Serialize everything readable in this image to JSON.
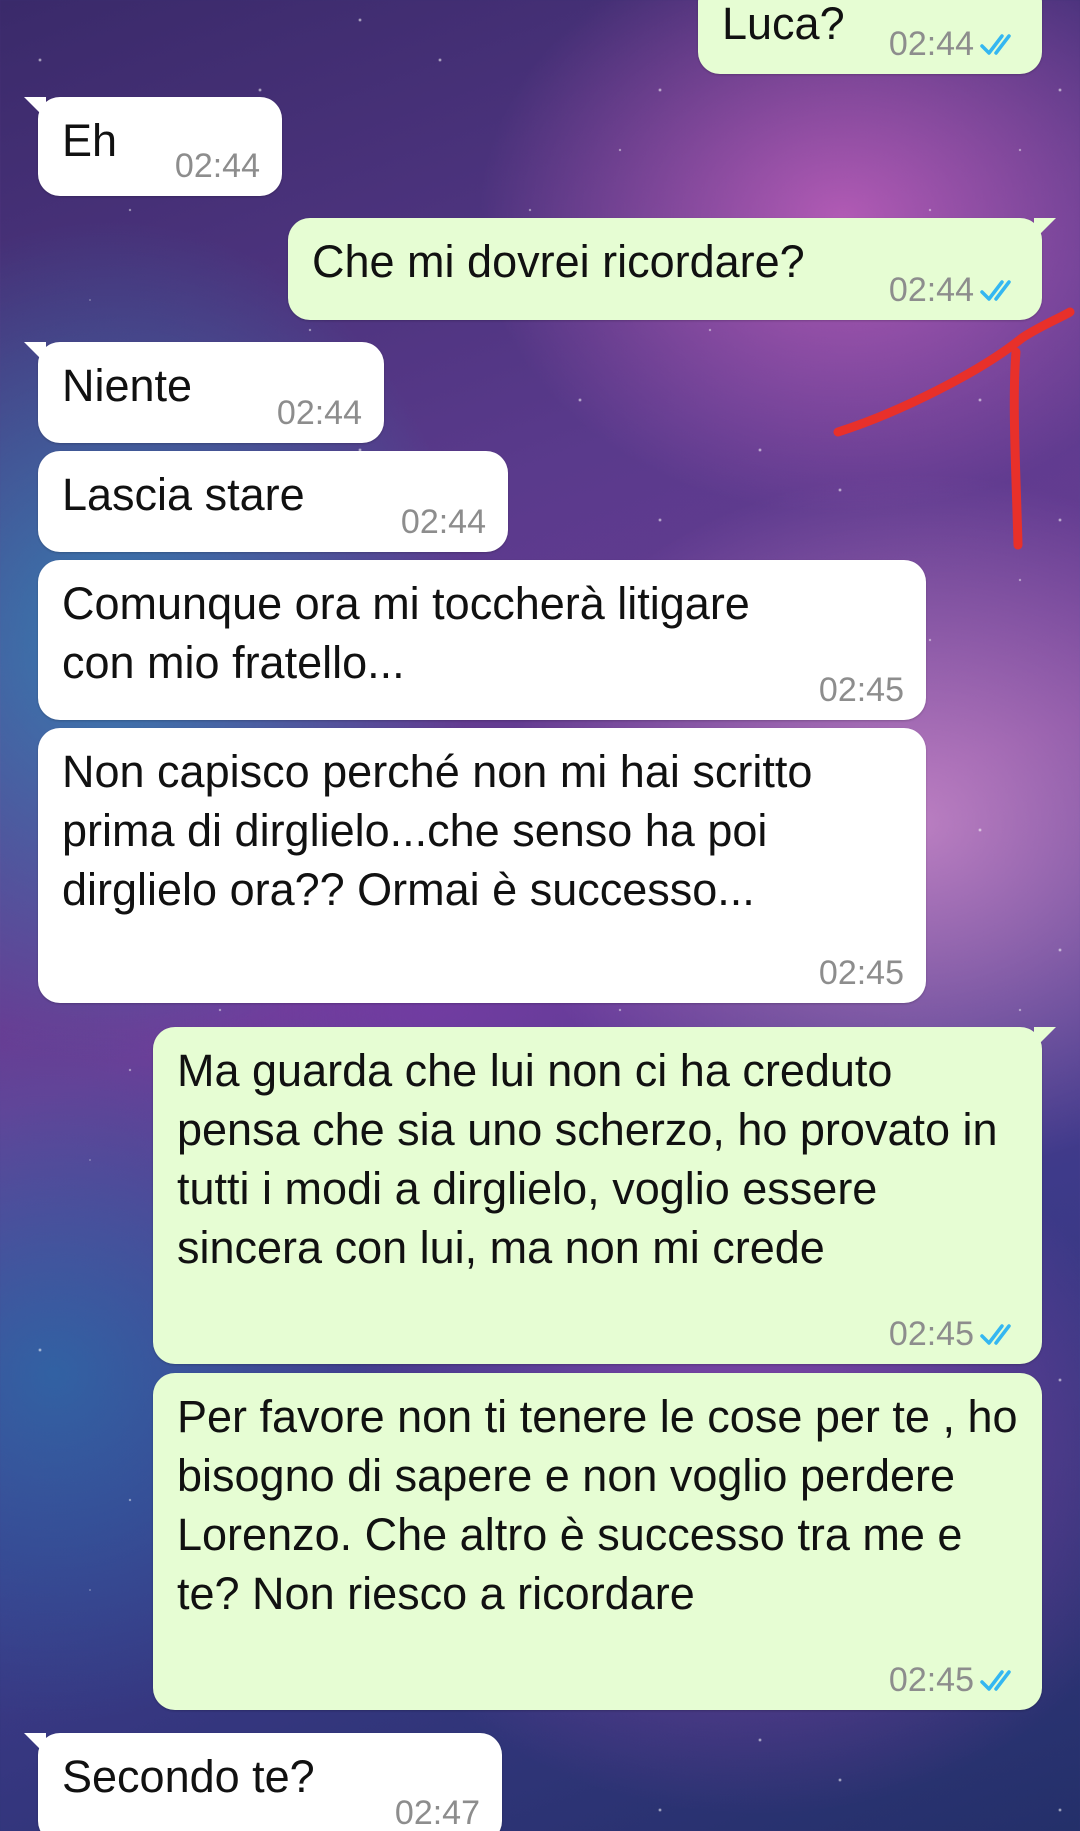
{
  "colors": {
    "incoming_bubble": "#ffffff",
    "outgoing_bubble": "#e6fdd3",
    "timestamp": "#8d8d8d",
    "read_check": "#34b7f1",
    "annotation_arrow": "#e8302a"
  },
  "icons": {
    "read_receipt": "double-check-icon"
  },
  "messages": [
    {
      "direction": "out",
      "text": "Luca?",
      "time": "02:44",
      "read": true
    },
    {
      "direction": "in",
      "text": "Eh",
      "time": "02:44"
    },
    {
      "direction": "out",
      "text": "Che mi dovrei ricordare?",
      "time": "02:44",
      "read": true
    },
    {
      "direction": "in",
      "text": "Niente",
      "time": "02:44"
    },
    {
      "direction": "in",
      "text": "Lascia stare",
      "time": "02:44"
    },
    {
      "direction": "in",
      "text": "Comunque ora mi toccherà litigare con mio fratello...",
      "time": "02:45"
    },
    {
      "direction": "in",
      "text": "Non capisco perché non mi hai scritto prima di dirglielo...che senso ha poi dirglielo ora?? Ormai è successo...",
      "time": "02:45"
    },
    {
      "direction": "out",
      "text": "Ma guarda che lui non ci ha creduto pensa che sia uno scherzo, ho provato in tutti i modi a dirglielo, voglio essere sincera con lui, ma non mi crede",
      "time": "02:45",
      "read": true
    },
    {
      "direction": "out",
      "text": "Per favore non ti tenere le cose per te , ho bisogno di sapere e non voglio perdere Lorenzo. Che altro è successo tra me e te? Non riesco a ricordare",
      "time": "02:45",
      "read": true
    },
    {
      "direction": "in",
      "text": "Secondo te?",
      "time": "02:47"
    }
  ]
}
